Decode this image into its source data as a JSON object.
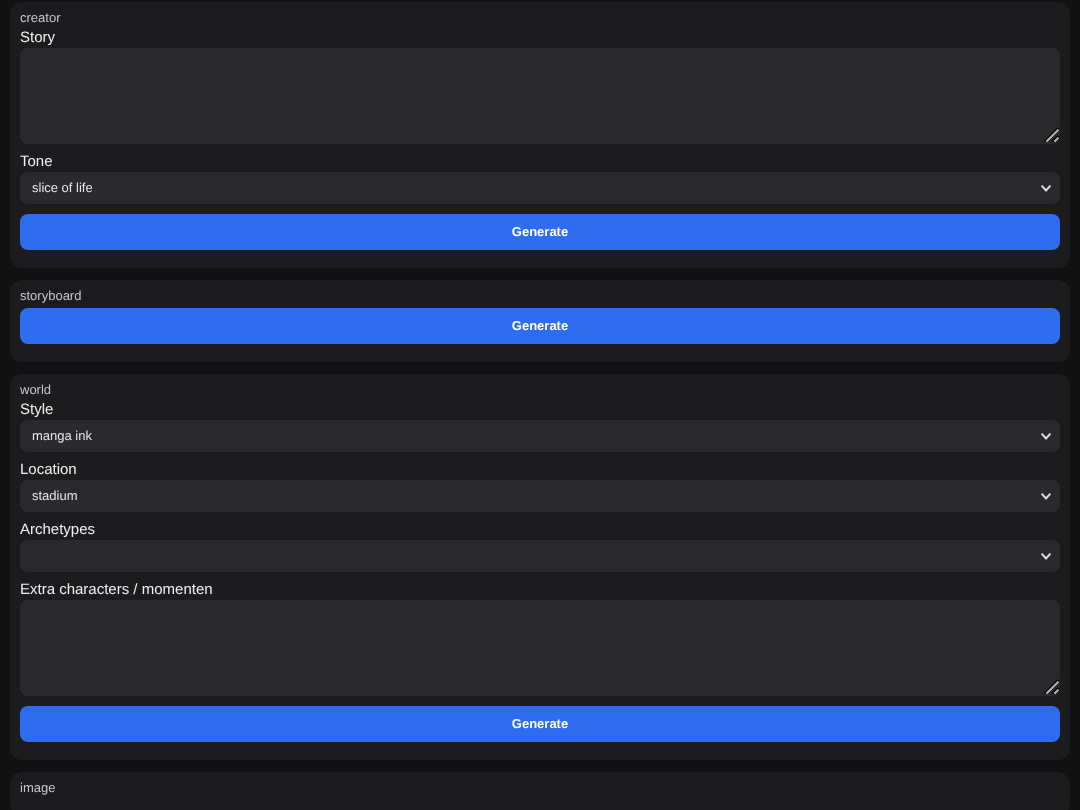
{
  "sections": [
    {
      "title": "creator",
      "fields": [
        {
          "kind": "textarea",
          "label": "Story"
        },
        {
          "kind": "select",
          "label": "Tone",
          "value": "slice of life"
        }
      ],
      "button": "Generate"
    },
    {
      "title": "storyboard",
      "button": "Generate"
    },
    {
      "title": "world",
      "fields": [
        {
          "kind": "select",
          "label": "Style",
          "value": "manga ink"
        },
        {
          "kind": "select",
          "label": "Location",
          "value": "stadium"
        },
        {
          "kind": "select",
          "label": "Archetypes"
        },
        {
          "kind": "textarea",
          "label": "Extra characters / momenten"
        }
      ],
      "button": "Generate"
    },
    {
      "title": "image"
    }
  ]
}
